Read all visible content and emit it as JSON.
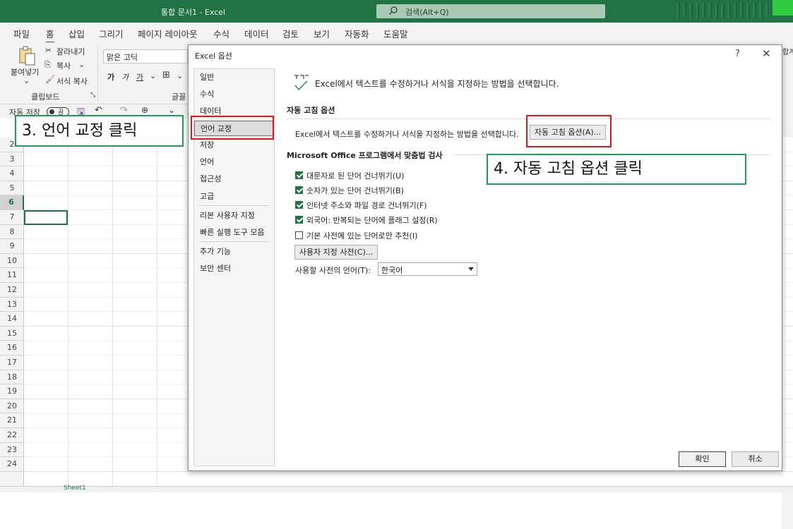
{
  "app": {
    "window_title": "통합 문서1 - Excel",
    "search_placeholder": "검색(Alt+Q)"
  },
  "menu": {
    "items": [
      "파일",
      "홈",
      "삽입",
      "그리기",
      "페이지 레이아웃",
      "수식",
      "데이터",
      "검토",
      "보기",
      "자동화",
      "도움말"
    ],
    "active": "홈"
  },
  "ribbon": {
    "paste_label": "붙여넣기",
    "cut_label": "잘라내기",
    "copy_label": "복사",
    "format_painter_label": "서식 복사",
    "clipboard_group": "클립보드",
    "font_name": "맑은 고딕",
    "font_group_partial": "글꼴",
    "bold_glyph": "가",
    "italic_glyph": "가",
    "underline_glyph": "가",
    "right_partial": "합계"
  },
  "qat": {
    "autosave_label": "자동 저장",
    "autosave_state": "끔"
  },
  "grid": {
    "rows": [
      "2",
      "3",
      "4",
      "5",
      "6",
      "7",
      "8",
      "9",
      "10",
      "11",
      "12",
      "13",
      "14",
      "15",
      "16",
      "17",
      "18",
      "19",
      "20",
      "21",
      "22",
      "23",
      "24"
    ],
    "selected_row": "6",
    "sheet_tab": "Sheet1"
  },
  "dialog": {
    "title": "Excel 옵션",
    "help": "?",
    "close": "✕",
    "nav": [
      "일반",
      "수식",
      "데이터",
      "언어 교정",
      "저장",
      "언어",
      "접근성",
      "고급",
      "리본 사용자 지정",
      "빠른 실행 도구 모음",
      "추가 기능",
      "보안 센터"
    ],
    "selected_nav": "언어 교정",
    "header_text": "Excel에서 텍스트를 수정하거나 서식을 지정하는 방법을 선택합니다.",
    "autocorrect_section": "자동 고침 옵션",
    "autocorrect_desc": "Excel에서 텍스트를 수정하거나 서식을 지정하는 방법을 선택합니다.",
    "autocorrect_button": "자동 고침 옵션(A)...",
    "spelling_section": "Microsoft Office 프로그램에서 맞춤법 검사",
    "checkboxes": [
      {
        "label": "대문자로 된 단어 건너뛰기(U)",
        "checked": true
      },
      {
        "label": "숫자가 있는 단어 건너뛰기(B)",
        "checked": true
      },
      {
        "label": "인터넷 주소와 파일 경로 건너뛰기(F)",
        "checked": true
      },
      {
        "label": "외국어: 반복되는 단어에 플래그 설정(R)",
        "checked": true
      },
      {
        "label": "기본 사전에 있는 단어로만 추천(I)",
        "checked": false
      }
    ],
    "custom_dict_button": "사용자 지정 사전(C)...",
    "dict_lang_label": "사용할 사전의 언어(T):",
    "dict_lang_value": "한국어",
    "ok_button": "확인",
    "cancel_button": "취소"
  },
  "annotations": {
    "step3": "3. 언어 교정 클릭",
    "step4": "4. 자동 고침 옵션 클릭"
  },
  "colors": {
    "excel_green": "#217346",
    "annotation_green": "#1f9d55",
    "highlight_red": "#e8141a"
  }
}
